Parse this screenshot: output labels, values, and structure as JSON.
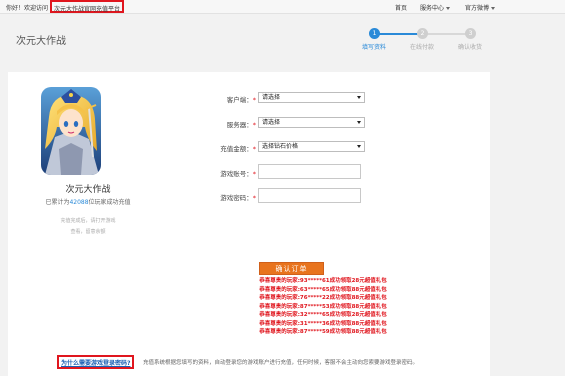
{
  "topbar": {
    "welcome": "你好！欢迎访问",
    "site_name": "次元大作战官网充值平台",
    "nav": {
      "home": "首页",
      "service": "服务中心",
      "official": "官方微博"
    }
  },
  "header": {
    "game_title": "次元大作战",
    "steps": [
      {
        "num": "1",
        "label": "填写资料",
        "active": true
      },
      {
        "num": "2",
        "label": "在线付款",
        "active": false
      },
      {
        "num": "3",
        "label": "确认收货",
        "active": false
      }
    ]
  },
  "game": {
    "name": "次元大作战",
    "count_prefix": "已累计为",
    "count": "42088",
    "count_suffix": "位玩家成功充值",
    "note1": "充值完成后，请打开游戏",
    "note2": "查看，留意余额"
  },
  "form": {
    "customer": {
      "label": "客户端：",
      "value": "请选择"
    },
    "server": {
      "label": "服务器：",
      "value": "请选择"
    },
    "amount": {
      "label": "充值金额：",
      "value": "选择钻石价格"
    },
    "account": {
      "label": "游戏账号：",
      "value": ""
    },
    "password": {
      "label": "游戏密码：",
      "value": ""
    },
    "required_mark": "*",
    "confirm": "确认订单"
  },
  "winners": [
    "恭喜尊贵的玩家:93*****61成功领取28元超值礼包",
    "恭喜尊贵的玩家:63*****65成功领取88元超值礼包",
    "恭喜尊贵的玩家:76*****22成功领取88元超值礼包",
    "恭喜尊贵的玩家:87*****53成功领取88元超值礼包",
    "恭喜尊贵的玩家:32*****65成功领取28元超值礼包",
    "恭喜尊贵的玩家:31*****36成功领取88元超值礼包",
    "恭喜尊贵的玩家:87*****59成功领取88元超值礼包"
  ],
  "footer": {
    "faq_link": "为什么需要游戏登录密码?",
    "faq_text": "充值系统根据您填写的资料，自动登录您的游戏账户进行充值，任何时候，客服不会主动向您索要游戏登录密码。"
  },
  "colors": {
    "accent": "#2a8ad8",
    "button": "#e8741e",
    "highlight": "#e0161e"
  }
}
